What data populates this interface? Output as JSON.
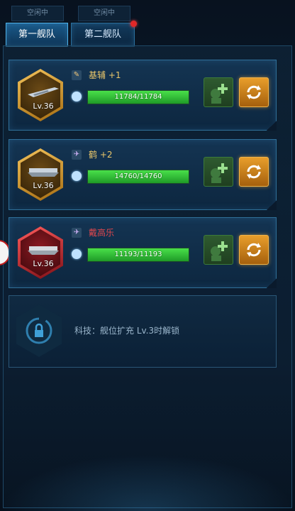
{
  "status_tabs": [
    "空闲中",
    "空闲中"
  ],
  "fleet_tabs": [
    {
      "label": "第一舰队",
      "active": true,
      "badge": false
    },
    {
      "label": "第二舰队",
      "active": false,
      "badge": true
    }
  ],
  "ships": [
    {
      "level": "Lv.36",
      "frame": "gold",
      "type_icon": "scout-tag-icon",
      "name": "基辅 +1",
      "name_color": "#e9c66a",
      "hp_text": "11784/11784",
      "hp_fraction": 1.0
    },
    {
      "level": "Lv.36",
      "frame": "gold",
      "type_icon": "plane-icon",
      "name": "鹤 +2",
      "name_color": "#e9c66a",
      "hp_text": "14760/14760",
      "hp_fraction": 1.0
    },
    {
      "level": "Lv.36",
      "frame": "red",
      "type_icon": "plane-icon",
      "name": "戴高乐",
      "name_color": "#e0474d",
      "hp_text": "11193/11193",
      "hp_fraction": 1.0
    }
  ],
  "locked_slot": {
    "text": "科技：舰位扩充 Lv.3时解锁",
    "icon": "lock-icon"
  },
  "colors": {
    "accent": "#4fb3ea",
    "gold": "#f2c25a",
    "hp": "#2ecb36",
    "swap": "#e89e2b"
  }
}
